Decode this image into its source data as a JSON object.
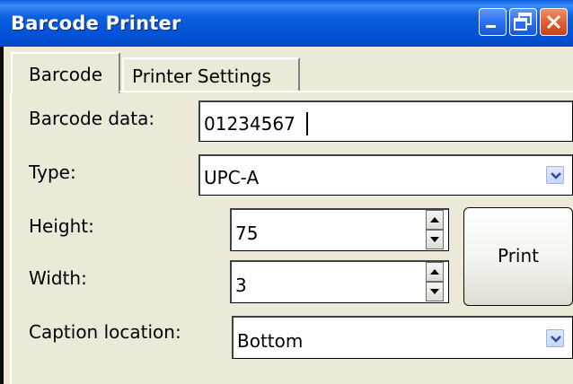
{
  "window": {
    "title": "Barcode Printer",
    "controls": [
      "minimize-icon",
      "restore-icon",
      "close-icon"
    ]
  },
  "tabs": [
    {
      "label": "Barcode",
      "selected": true
    },
    {
      "label": "Printer Settings",
      "selected": false
    }
  ],
  "form": {
    "barcode_data_label": "Barcode data:",
    "barcode_data_value": "01234567",
    "type_label": "Type:",
    "type_value": "UPC-A",
    "height_label": "Height:",
    "height_value": "75",
    "width_label": "Width:",
    "width_value": "3",
    "caption_label": "Caption location:",
    "caption_value": "Bottom",
    "print_label": "Print"
  },
  "colors": {
    "titlebar": "#0553d8",
    "close_button": "#e25b30",
    "window_bg": "#ece9d8"
  }
}
